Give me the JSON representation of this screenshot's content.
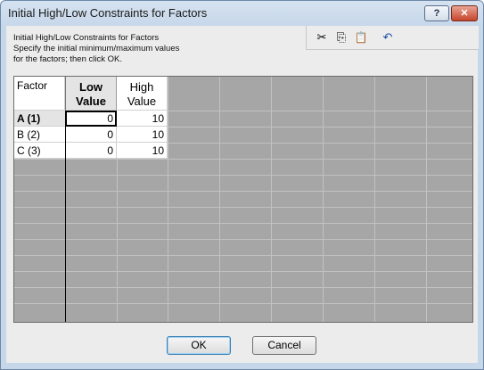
{
  "window": {
    "title": "Initial High/Low Constraints for Factors",
    "help_label": "?",
    "close_label": "✕"
  },
  "description": {
    "line1": "Initial High/Low Constraints for Factors",
    "line2": "Specify the initial minimum/maximum values",
    "line3": "for the factors; then click OK."
  },
  "toolbar": {
    "cut_glyph": "✂",
    "copy_glyph": "⎘",
    "paste_glyph": "📋",
    "undo_glyph": "↶"
  },
  "table": {
    "columns": [
      "Factor",
      "Low Value",
      "High Value"
    ],
    "rows": [
      {
        "factor": "A  (1)",
        "low": "0",
        "high": "10"
      },
      {
        "factor": "B  (2)",
        "low": "0",
        "high": "10"
      },
      {
        "factor": "C  (3)",
        "low": "0",
        "high": "10"
      }
    ]
  },
  "buttons": {
    "ok": "OK",
    "cancel": "Cancel"
  }
}
